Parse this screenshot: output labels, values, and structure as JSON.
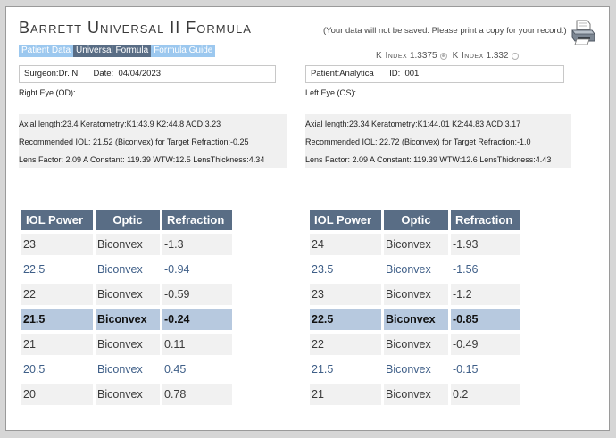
{
  "header": {
    "title": "Barrett Universal II Formula",
    "notice": "(Your data will not be saved.  Please print a copy for your record.)"
  },
  "tabs": [
    "Patient Data",
    "Universal Formula",
    "Formula Guide"
  ],
  "k_index": {
    "options": [
      {
        "label": "K Index",
        "value": "1.3375",
        "selected": true
      },
      {
        "label": "K Index",
        "value": "1.332",
        "selected": false
      }
    ]
  },
  "surgeon_box": {
    "surgeon_label": "Surgeon:",
    "surgeon": "Dr. N",
    "date_label": "Date:",
    "date": "04/04/2023"
  },
  "patient_box": {
    "patient_label": "Patient:",
    "patient": "Analytica",
    "id_label": "ID:",
    "id": "001"
  },
  "right_eye": {
    "label": "Right Eye (OD):",
    "line1": "Axial length:23.4  Keratometry:K1:43.9 K2:44.8  ACD:3.23",
    "line2": "Recommended IOL: 21.52 (Biconvex) for Target Refraction:-0.25",
    "line3": "Lens Factor: 2.09 A Constant: 119.39 WTW:12.5 LensThickness:4.34",
    "table": {
      "headers": [
        "IOL Power",
        "Optic",
        "Refraction"
      ],
      "selected_index": 3,
      "rows": [
        [
          "23",
          "Biconvex",
          "-1.3"
        ],
        [
          "22.5",
          "Biconvex",
          "-0.94"
        ],
        [
          "22",
          "Biconvex",
          "-0.59"
        ],
        [
          "21.5",
          "Biconvex",
          "-0.24"
        ],
        [
          "21",
          "Biconvex",
          "0.11"
        ],
        [
          "20.5",
          "Biconvex",
          "0.45"
        ],
        [
          "20",
          "Biconvex",
          "0.78"
        ]
      ]
    }
  },
  "left_eye": {
    "label": "Left Eye (OS):",
    "line1": "Axial length:23.34  Keratometry:K1:44.01 K2:44.83  ACD:3.17",
    "line2": "Recommended IOL: 22.72 (Biconvex) for Target Refraction:-1.0",
    "line3": "Lens Factor: 2.09 A Constant: 119.39 WTW:12.6 LensThickness:4.43",
    "table": {
      "headers": [
        "IOL Power",
        "Optic",
        "Refraction"
      ],
      "selected_index": 3,
      "rows": [
        [
          "24",
          "Biconvex",
          "-1.93"
        ],
        [
          "23.5",
          "Biconvex",
          "-1.56"
        ],
        [
          "23",
          "Biconvex",
          "-1.2"
        ],
        [
          "22.5",
          "Biconvex",
          "-0.85"
        ],
        [
          "22",
          "Biconvex",
          "-0.49"
        ],
        [
          "21.5",
          "Biconvex",
          "-0.15"
        ],
        [
          "21",
          "Biconvex",
          "0.2"
        ]
      ]
    }
  },
  "colors": {
    "header_blue": "#596d85",
    "tab_light": "#9cc8ef",
    "selected_row": "#b7c9df",
    "alt_text_blue": "#3f5f88"
  },
  "icons": {
    "print": "printer-icon"
  }
}
